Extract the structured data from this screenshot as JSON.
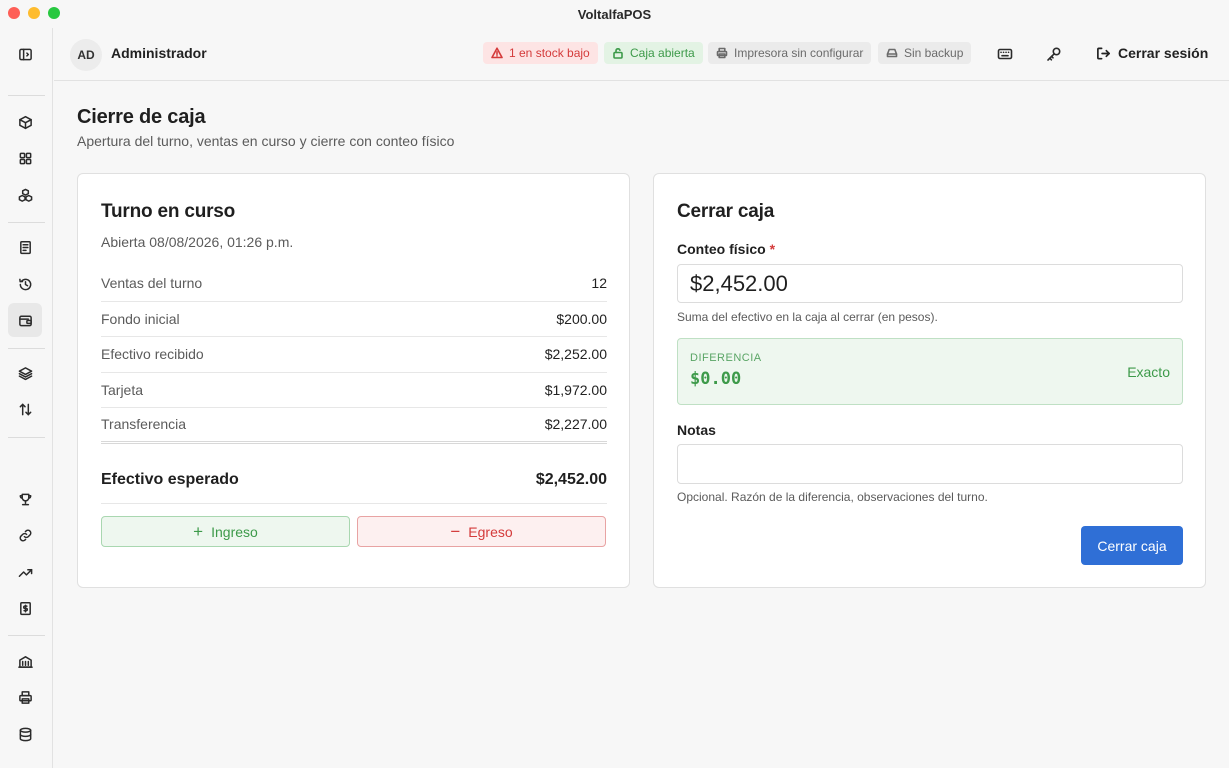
{
  "window": {
    "title": "VoltalfaPOS"
  },
  "user": {
    "initials": "AD",
    "name": "Administrador"
  },
  "status": {
    "low_stock": "1 en stock bajo",
    "register": "Caja abierta",
    "printer": "Impresora sin configurar",
    "backup": "Sin backup"
  },
  "header": {
    "logout_label": "Cerrar sesión"
  },
  "page": {
    "title": "Cierre de caja",
    "subtitle": "Apertura del turno, ventas en curso y cierre con conteo físico"
  },
  "shift": {
    "title": "Turno en curso",
    "opened": "Abierta 08/08/2026, 01:26 p.m.",
    "rows": [
      {
        "label": "Ventas del turno",
        "value": "12"
      },
      {
        "label": "Fondo inicial",
        "value": "$200.00"
      },
      {
        "label": "Efectivo recibido",
        "value": "$2,252.00"
      },
      {
        "label": "Tarjeta",
        "value": "$1,972.00"
      },
      {
        "label": "Transferencia",
        "value": "$2,227.00"
      }
    ],
    "expected_label": "Efectivo esperado",
    "expected_value": "$2,452.00",
    "income_label": "Ingreso",
    "expense_label": "Egreso"
  },
  "close": {
    "title": "Cerrar caja",
    "count_label": "Conteo físico",
    "required_mark": "*",
    "count_value": "$2,452.00",
    "count_hint": "Suma del efectivo en la caja al cerrar (en pesos).",
    "diff_label": "DIFERENCIA",
    "diff_value": "$0.00",
    "diff_status": "Exacto",
    "notes_label": "Notas",
    "notes_value": "",
    "notes_hint": "Opcional. Razón de la diferencia, observaciones del turno.",
    "submit_label": "Cerrar caja"
  },
  "colors": {
    "accent": "#2f6fd6",
    "success": "#3d9a4a",
    "danger": "#d43b3b"
  },
  "icons": {
    "sidebar": [
      "sidebar-toggle-icon",
      "box-icon",
      "grid-icon",
      "boxes-icon",
      "receipt-icon",
      "history-icon",
      "wallet-icon",
      "layers-icon",
      "arrows-updown-icon",
      "trophy-icon",
      "link-icon",
      "trending-up-icon",
      "invoice-icon",
      "building-icon",
      "printer-icon",
      "database-icon"
    ],
    "header": [
      "keyboard-icon",
      "key-icon",
      "logout-icon"
    ]
  }
}
